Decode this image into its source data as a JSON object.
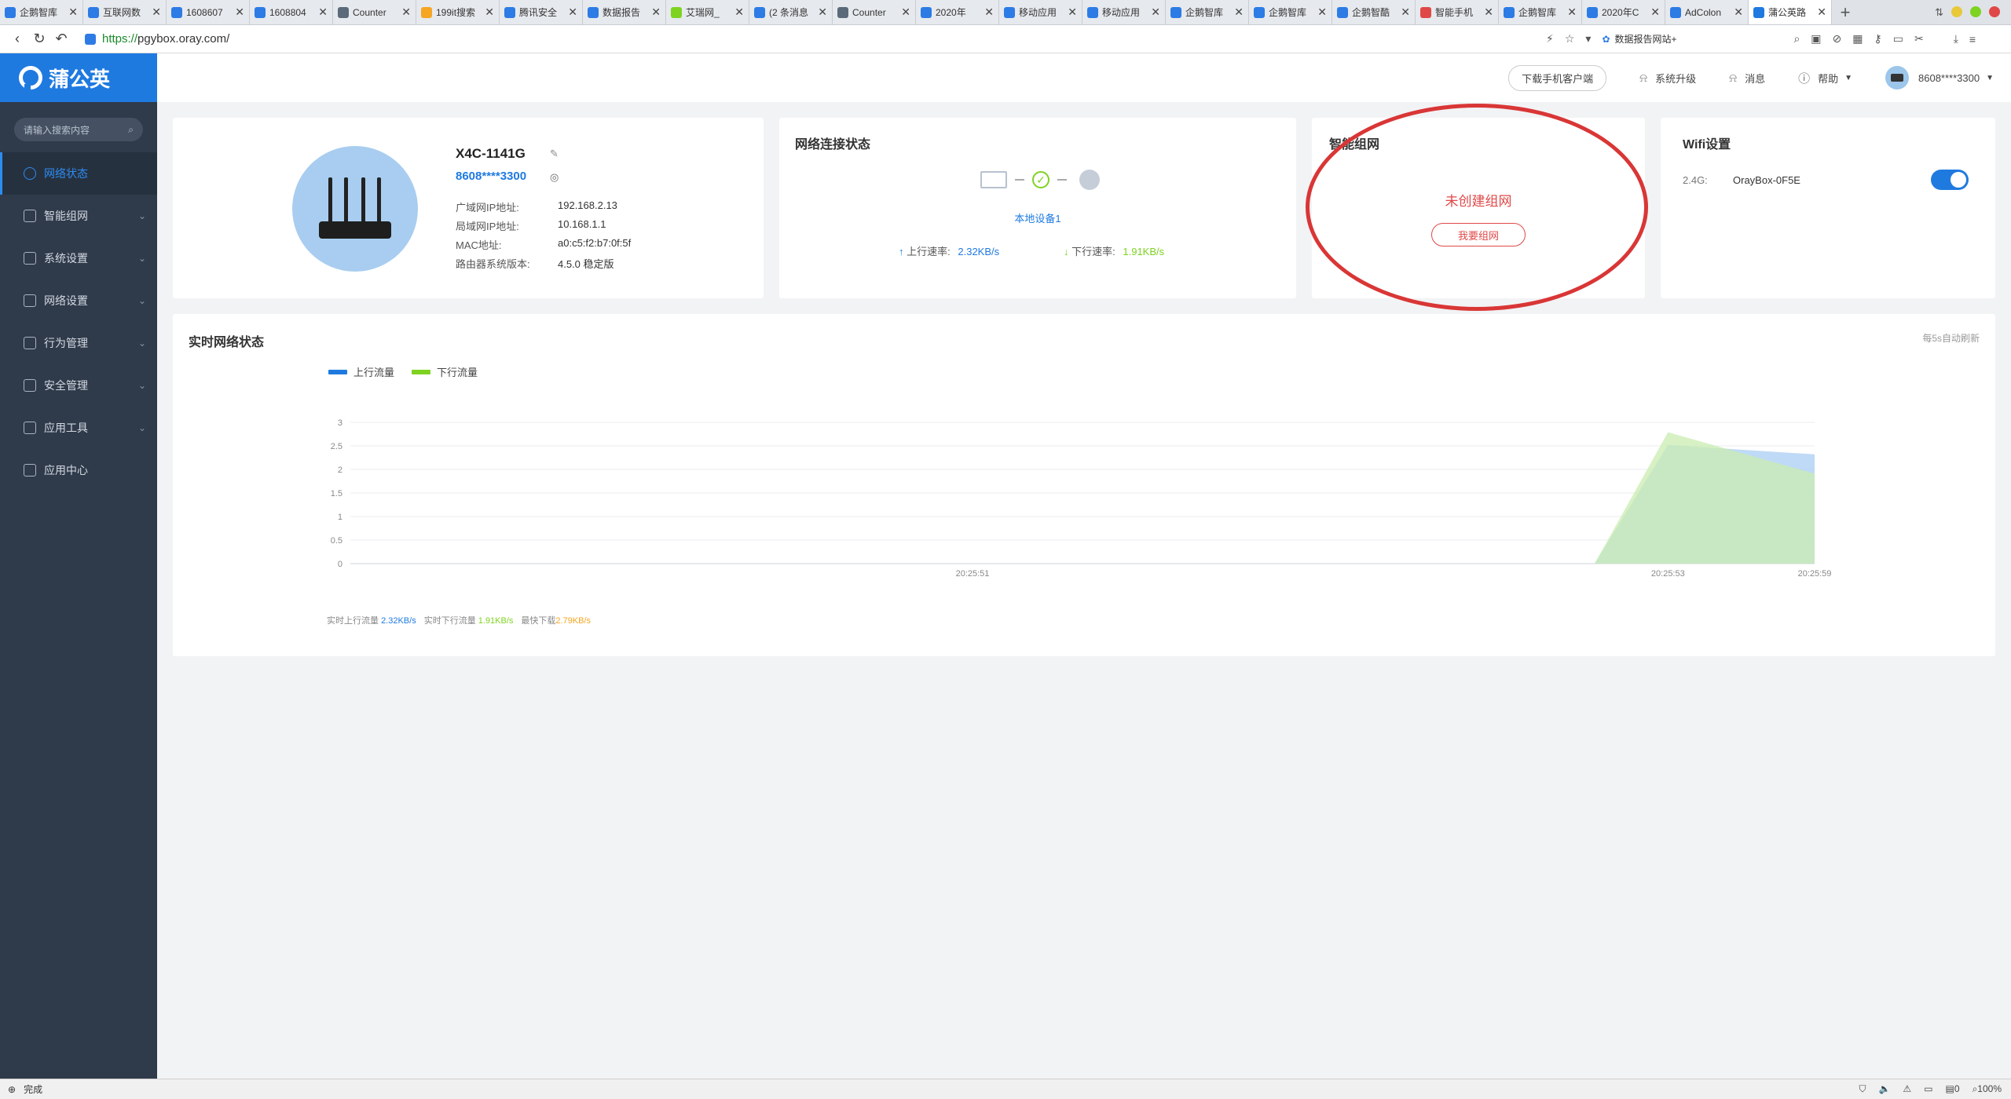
{
  "browser": {
    "tabs": [
      {
        "title": "企鹅智库",
        "color": "#2d7be5"
      },
      {
        "title": "互联网数",
        "color": "#2d7be5"
      },
      {
        "title": "1608607",
        "color": "#2d7be5"
      },
      {
        "title": "1608804",
        "color": "#2d7be5"
      },
      {
        "title": "Counter",
        "color": "#5a6a7a"
      },
      {
        "title": "199it搜索",
        "color": "#f5a623"
      },
      {
        "title": "腾讯安全",
        "color": "#2d7be5"
      },
      {
        "title": "数据报告",
        "color": "#2d7be5"
      },
      {
        "title": "艾瑞网_",
        "color": "#7ed321"
      },
      {
        "title": "(2 条消息",
        "color": "#2d7be5"
      },
      {
        "title": "Counter",
        "color": "#5a6a7a"
      },
      {
        "title": "2020年",
        "color": "#2d7be5"
      },
      {
        "title": "移动应用",
        "color": "#2d7be5"
      },
      {
        "title": "移动应用",
        "color": "#2d7be5"
      },
      {
        "title": "企鹅智库",
        "color": "#2d7be5"
      },
      {
        "title": "企鹅智库",
        "color": "#2d7be5"
      },
      {
        "title": "企鹅智酷",
        "color": "#2d7be5"
      },
      {
        "title": "智能手机",
        "color": "#e04848"
      },
      {
        "title": "企鹅智库",
        "color": "#2d7be5"
      },
      {
        "title": "2020年C",
        "color": "#2d7be5"
      },
      {
        "title": "AdColon",
        "color": "#2d7be5"
      },
      {
        "title": "蒲公英路",
        "color": "#1f7ae0",
        "active": true
      }
    ],
    "url_scheme": "https://",
    "url_rest": "pgybox.oray.com/",
    "search_suggestion": "数据报告网站+",
    "status": "完成",
    "zoom": "100%",
    "status_count": "0"
  },
  "app": {
    "logo": "蒲公英",
    "search_placeholder": "请输入搜索内容",
    "nav": [
      {
        "label": "网络状态",
        "icon": "dashboard-icon",
        "active": true
      },
      {
        "label": "智能组网",
        "icon": "mesh-icon"
      },
      {
        "label": "系统设置",
        "icon": "settings-icon"
      },
      {
        "label": "网络设置",
        "icon": "network-icon"
      },
      {
        "label": "行为管理",
        "icon": "behavior-icon"
      },
      {
        "label": "安全管理",
        "icon": "shield-icon"
      },
      {
        "label": "应用工具",
        "icon": "toolbox-icon"
      },
      {
        "label": "应用中心",
        "icon": "app-center-icon"
      }
    ],
    "header": {
      "download": "下载手机客户端",
      "upgrade": "系统升级",
      "messages": "消息",
      "help": "帮助",
      "user": "8608****3300"
    }
  },
  "device": {
    "name": "X4C-1141G",
    "sn": "8608****3300",
    "rows": [
      {
        "k": "广域网IP地址:",
        "v": "192.168.2.13"
      },
      {
        "k": "局域网IP地址:",
        "v": "10.168.1.1"
      },
      {
        "k": "MAC地址:",
        "v": "a0:c5:f2:b7:0f:5f"
      },
      {
        "k": "路由器系统版本:",
        "v": "4.5.0 稳定版"
      }
    ]
  },
  "network": {
    "title": "网络连接状态",
    "local_device": "本地设备1",
    "up_label": "上行速率:",
    "up_value": "2.32KB/s",
    "down_label": "下行速率:",
    "down_value": "1.91KB/s"
  },
  "mesh": {
    "title": "智能组网",
    "status": "未创建组网",
    "button": "我要组网"
  },
  "wifi": {
    "title": "Wifi设置",
    "band": "2.4G:",
    "ssid": "OrayBox-0F5E",
    "enabled": true
  },
  "realtime": {
    "title": "实时网络状态",
    "auto_refresh": "每5s自动刷新",
    "footer": {
      "up_label": "实时上行流量",
      "up_value": "2.32KB/s",
      "down_label": "实时下行流量",
      "down_value": "1.91KB/s",
      "max_label": "最快下载",
      "max_value": "2.79KB/s"
    }
  },
  "chart_data": {
    "type": "area",
    "x": [
      "",
      "20:25:51",
      "",
      "20:25:53",
      "",
      "20:25:59"
    ],
    "ylim": [
      0,
      3
    ],
    "yticks": [
      0,
      0.5,
      1,
      1.5,
      2,
      2.5,
      3
    ],
    "grid": true,
    "legend": "top-left",
    "series": [
      {
        "name": "上行流量",
        "color": "#1f7ae0",
        "fill": "#a9cdf3",
        "values": [
          null,
          null,
          0,
          2.52,
          null,
          2.32
        ]
      },
      {
        "name": "下行流量",
        "color": "#7ed321",
        "fill": "#c9ecb0",
        "values": [
          null,
          null,
          0,
          2.79,
          null,
          1.91
        ]
      }
    ]
  }
}
